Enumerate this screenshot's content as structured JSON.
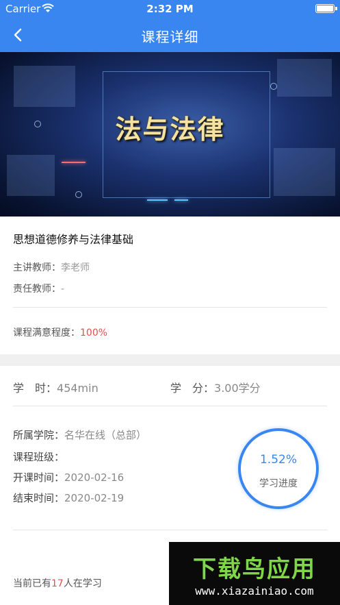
{
  "status_bar": {
    "carrier": "Carrier",
    "time": "2:32 PM"
  },
  "nav": {
    "title": "课程详细",
    "back_icon": "chevron-left-icon"
  },
  "banner": {
    "title": "法与法律"
  },
  "course": {
    "name": "思想道德修养与法律基础",
    "lecturer_label": "主讲教师：",
    "lecturer_value": "李老师",
    "responsible_label": "责任教师：",
    "responsible_value": "-",
    "satisfaction_label": "课程满意程度：",
    "satisfaction_value": "100%"
  },
  "stats": {
    "hours_label": "学　时：",
    "hours_value": "454min",
    "credits_label": "学　分：",
    "credits_value": "3.00学分"
  },
  "details": {
    "college_label": "所属学院：",
    "college_value": "名华在线（总部）",
    "class_label": "课程班级：",
    "class_value": "",
    "start_label": "开课时间：",
    "start_value": "2020-02-16",
    "end_label": "结束时间：",
    "end_value": "2020-02-19"
  },
  "progress": {
    "percent_text": "1.52%",
    "label": "学习进度",
    "value": 0.0152
  },
  "footer": {
    "prefix": "当前已有",
    "count": "17",
    "suffix": "人在学习"
  },
  "watermark": {
    "brand": "下载鸟应用",
    "url": "www.xiazainiao.com"
  },
  "colors": {
    "primary": "#3a86f0",
    "accent_red": "#e05050"
  }
}
